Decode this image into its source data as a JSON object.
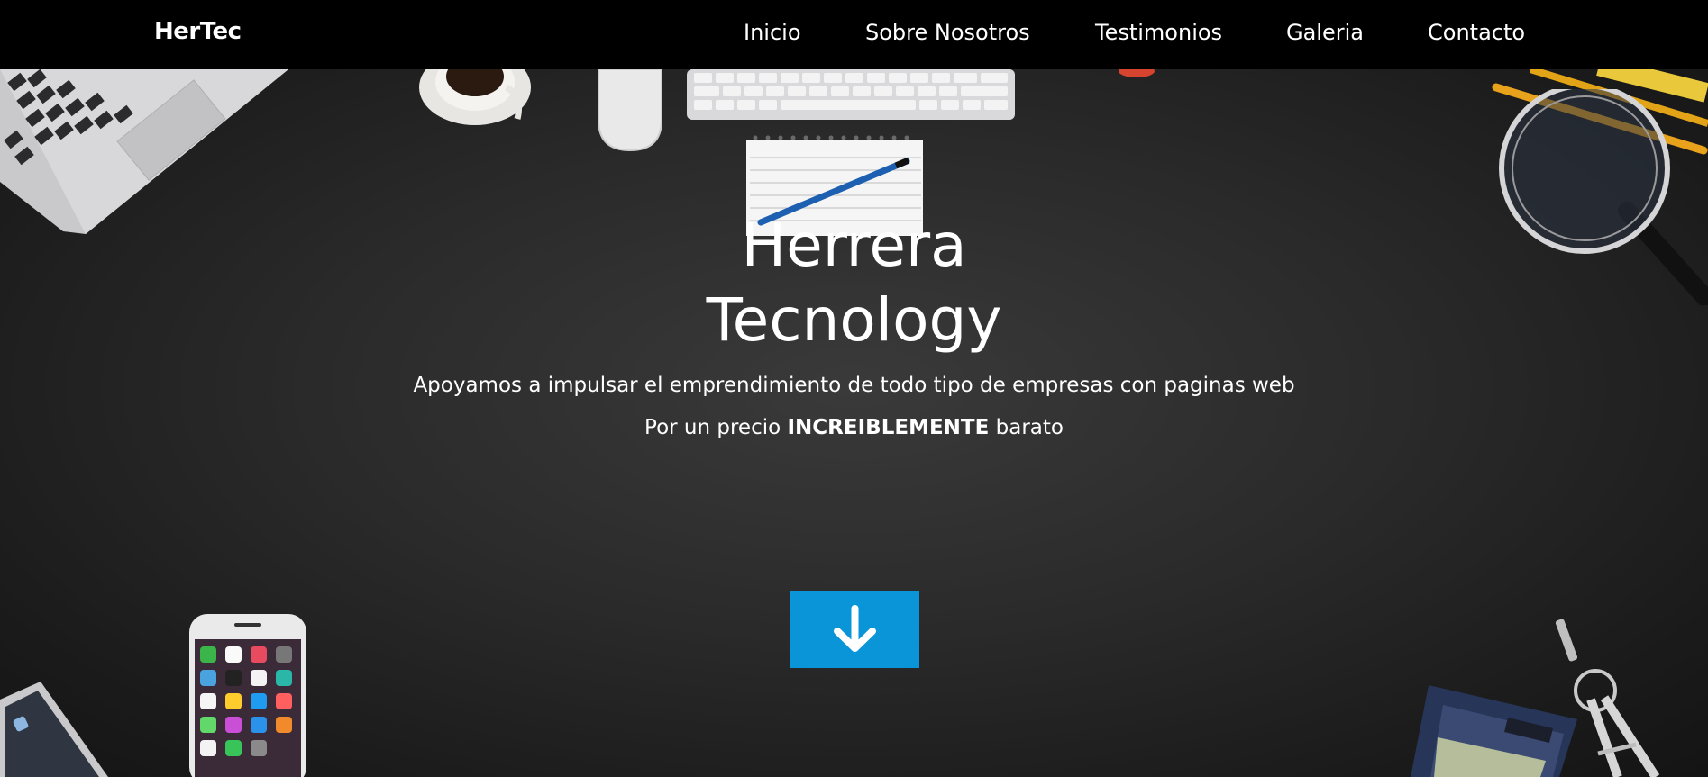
{
  "navbar": {
    "brand": "HerTec",
    "links": [
      "Inicio",
      "Sobre Nosotros",
      "Testimonios",
      "Galeria",
      "Contacto"
    ]
  },
  "hero": {
    "title_line1": "Herrera",
    "title_line2": "Tecnology",
    "subtitle": "Apoyamos a impulsar el emprendimiento de todo tipo de empresas con paginas web",
    "price_prefix": "Por un precio",
    "price_emphasis": "INCREIBLEMENTE",
    "price_suffix": "barato",
    "scroll_icon": "arrow-down-icon"
  },
  "colors": {
    "navbar_bg": "#000000",
    "hero_bg": "#2a2a2a",
    "accent": "#0b95d9",
    "text": "#ffffff"
  }
}
